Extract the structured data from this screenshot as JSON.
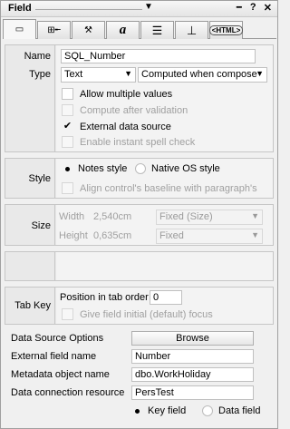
{
  "titlebar": {
    "title": "Field",
    "chevron": "▼",
    "icons": [
      {
        "name": "grip-icon",
        "glyph": "▪▪▪▪"
      },
      {
        "name": "help-icon",
        "glyph": "?"
      },
      {
        "name": "close-icon",
        "glyph": "✕"
      }
    ]
  },
  "tabs": [
    {
      "name": "tab-basics",
      "glyph": "▭",
      "active": true
    },
    {
      "name": "tab-control",
      "glyph": "⊞╾"
    },
    {
      "name": "tab-options",
      "glyph": "⚒"
    },
    {
      "name": "tab-font",
      "glyph": "a"
    },
    {
      "name": "tab-paragraph",
      "glyph": "☰"
    },
    {
      "name": "tab-hide-when",
      "glyph": "⊥"
    },
    {
      "name": "tab-html",
      "glyph": "<HTML>"
    }
  ],
  "basics": {
    "name_label": "Name",
    "name_value": "SQL_Number",
    "type_label": "Type",
    "type_value": "Text",
    "compute_value": "Computed when compose",
    "options": [
      {
        "label": "Allow multiple values",
        "checked": false,
        "disabled": false
      },
      {
        "label": "Compute after validation",
        "checked": false,
        "disabled": true
      },
      {
        "label": "External data source",
        "checked": true,
        "disabled": false
      },
      {
        "label": "Enable instant spell check",
        "checked": false,
        "disabled": true
      }
    ]
  },
  "style": {
    "label": "Style",
    "notes_style": "Notes style",
    "native_style": "Native OS style",
    "align_baseline": "Align control's baseline with paragraph's"
  },
  "size": {
    "label": "Size",
    "width_label": "Width",
    "width_value": "2,540cm",
    "width_mode": "Fixed (Size)",
    "height_label": "Height",
    "height_value": "0,635cm",
    "height_mode": "Fixed"
  },
  "tabkey": {
    "label": "Tab Key",
    "position_label": "Position in tab order",
    "position_value": "0",
    "initial_focus": "Give field initial (default) focus"
  },
  "datasource": {
    "options_label": "Data Source Options",
    "browse_button": "Browse",
    "external_field_label": "External field name",
    "external_field_value": "Number",
    "metadata_label": "Metadata object name",
    "metadata_value": "dbo.WorkHoliday",
    "connection_label": "Data connection resource",
    "connection_value": "PersTest",
    "key_field": "Key field",
    "data_field": "Data field"
  }
}
